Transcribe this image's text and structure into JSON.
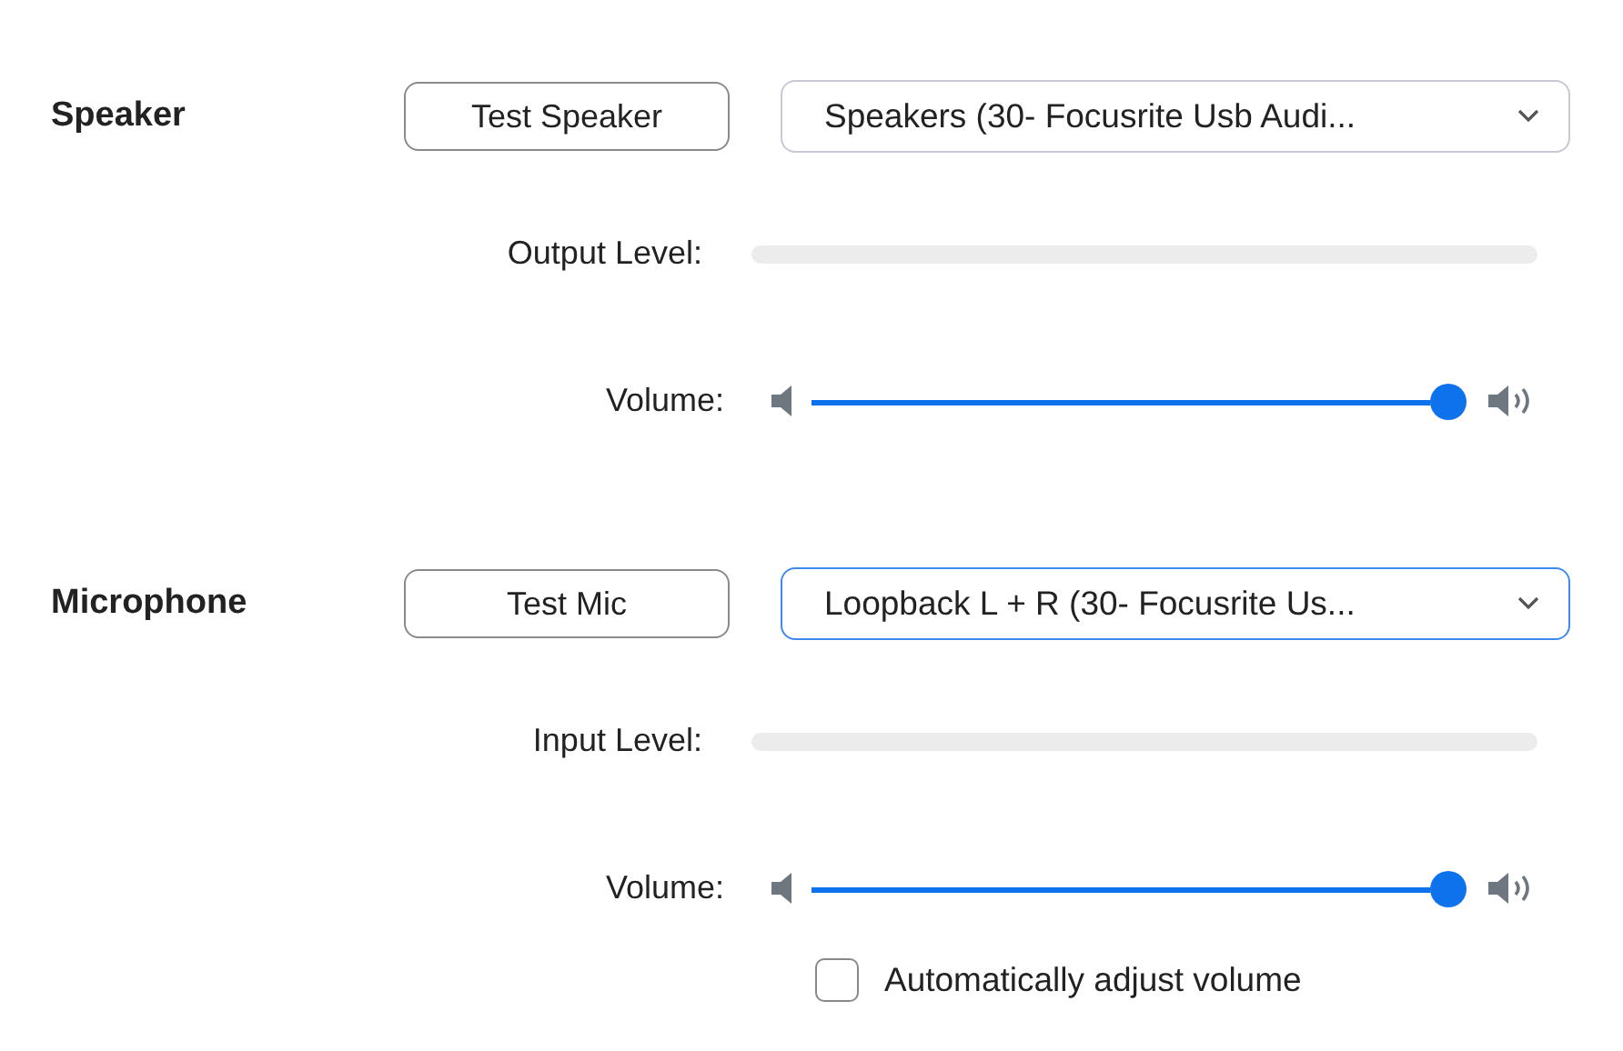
{
  "sections": [
    {
      "title": "Speaker",
      "test_button": "Test Speaker",
      "device": {
        "value": "Speakers (30- Focusrite Usb Audi...",
        "focused": false
      },
      "level_label": "Output Level:",
      "volume_label": "Volume:",
      "volume": {
        "level": 1
      }
    },
    {
      "title": "Microphone",
      "test_button": "Test Mic",
      "device": {
        "value": "Loopback L + R (30- Focusrite Us...",
        "focused": true
      },
      "level_label": "Input Level:",
      "volume_label": "Volume:",
      "volume": {
        "level": 1
      },
      "auto_adjust": {
        "label": "Automatically adjust volume",
        "checked": false
      }
    }
  ]
}
